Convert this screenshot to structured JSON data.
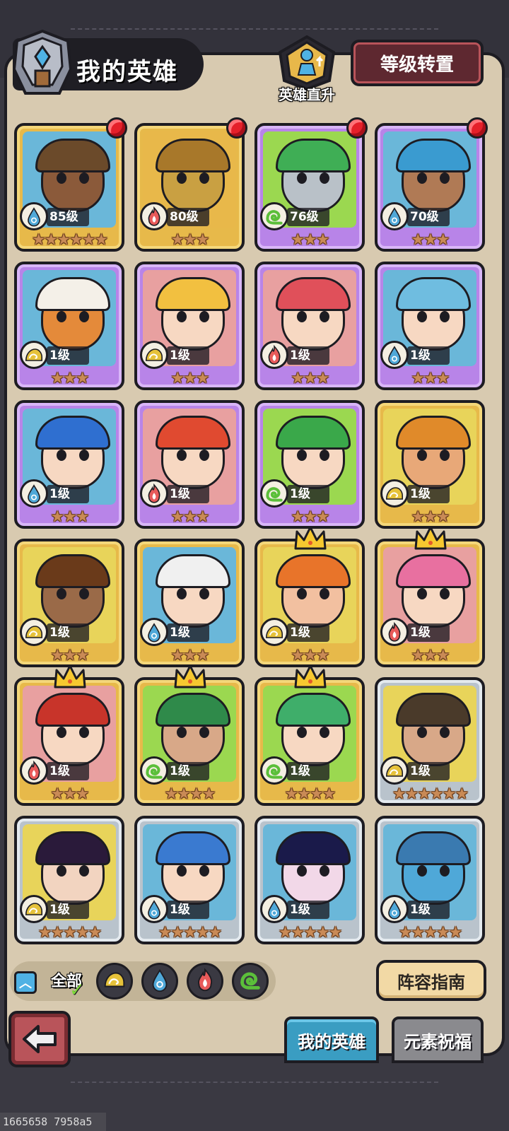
{
  "header": {
    "title": "我的英雄",
    "level_up_label": "英雄直升",
    "transfer_button": "等级转置"
  },
  "colors": {
    "panel": "#d8cab0",
    "rarity_gold": "#e7b94a",
    "rarity_purple": "#b884e8",
    "rarity_silver": "#b9c3cc",
    "element_water": "#4fa8d8",
    "element_fire": "#e85a5a",
    "element_wind": "#5bbf3a",
    "element_earth": "#e6c23a"
  },
  "heroes": [
    {
      "level": "85级",
      "stars": "★★★★★★",
      "element": "water",
      "rarity": "gold",
      "reddot": true,
      "crown": false,
      "bg": "#6ab7d9",
      "skin": "#8b5a3a",
      "hair": "#6b4a2a"
    },
    {
      "level": "80级",
      "stars": "★★★",
      "element": "fire",
      "rarity": "gold",
      "reddot": true,
      "crown": false,
      "bg": "#e8b84a",
      "skin": "#c9a042",
      "hair": "#a8782a"
    },
    {
      "level": "76级",
      "stars": "★★★",
      "element": "wind",
      "rarity": "purple",
      "reddot": true,
      "crown": false,
      "bg": "#9bd850",
      "skin": "#b9c1c8",
      "hair": "#3fae55"
    },
    {
      "level": "70级",
      "stars": "★★★",
      "element": "water",
      "rarity": "purple",
      "reddot": true,
      "crown": false,
      "bg": "#6ab7d9",
      "skin": "#b07a55",
      "hair": "#3a9bd0"
    },
    {
      "level": "1级",
      "stars": "★★★",
      "element": "earth",
      "rarity": "purple",
      "reddot": false,
      "crown": false,
      "bg": "#6ab7d9",
      "skin": "#e48a3a",
      "hair": "#f4f0e8"
    },
    {
      "level": "1级",
      "stars": "★★★",
      "element": "earth",
      "rarity": "purple",
      "reddot": false,
      "crown": false,
      "bg": "#e8a0a0",
      "skin": "#f7d8c2",
      "hair": "#f2c040"
    },
    {
      "level": "1级",
      "stars": "★★★",
      "element": "fire",
      "rarity": "purple",
      "reddot": false,
      "crown": false,
      "bg": "#e8a0a0",
      "skin": "#f7d8c2",
      "hair": "#e0505a"
    },
    {
      "level": "1级",
      "stars": "★★★",
      "element": "water",
      "rarity": "purple",
      "reddot": false,
      "crown": false,
      "bg": "#6ab7d9",
      "skin": "#f7d8c2",
      "hair": "#6fbde0"
    },
    {
      "level": "1级",
      "stars": "★★★",
      "element": "water",
      "rarity": "purple",
      "reddot": false,
      "crown": false,
      "bg": "#6ab7d9",
      "skin": "#f7d8c2",
      "hair": "#2f6fd0"
    },
    {
      "level": "1级",
      "stars": "★★★",
      "element": "fire",
      "rarity": "purple",
      "reddot": false,
      "crown": false,
      "bg": "#e8a0a0",
      "skin": "#f7d8c2",
      "hair": "#e04a30"
    },
    {
      "level": "1级",
      "stars": "★★★",
      "element": "wind",
      "rarity": "purple",
      "reddot": false,
      "crown": false,
      "bg": "#9bd850",
      "skin": "#f7d8c2",
      "hair": "#3aa84a"
    },
    {
      "level": "1级",
      "stars": "★★★",
      "element": "earth",
      "rarity": "gold",
      "reddot": false,
      "crown": false,
      "bg": "#e8d45a",
      "skin": "#e8a878",
      "hair": "#e08a2a"
    },
    {
      "level": "1级",
      "stars": "★★★",
      "element": "earth",
      "rarity": "gold",
      "reddot": false,
      "crown": false,
      "bg": "#e8d45a",
      "skin": "#9a6a48",
      "hair": "#6a3a1a"
    },
    {
      "level": "1级",
      "stars": "★★★",
      "element": "water",
      "rarity": "gold",
      "reddot": false,
      "crown": false,
      "bg": "#6ab7d9",
      "skin": "#f7d8c2",
      "hair": "#f0f0f0"
    },
    {
      "level": "1级",
      "stars": "★★★",
      "element": "earth",
      "rarity": "gold",
      "reddot": false,
      "crown": true,
      "bg": "#e8d45a",
      "skin": "#f2c0a0",
      "hair": "#e8742a"
    },
    {
      "level": "1级",
      "stars": "★★★",
      "element": "fire",
      "rarity": "gold",
      "reddot": false,
      "crown": true,
      "bg": "#e8a0a0",
      "skin": "#f7d8c2",
      "hair": "#e870a0"
    },
    {
      "level": "1级",
      "stars": "★★★",
      "element": "fire",
      "rarity": "gold",
      "reddot": false,
      "crown": true,
      "bg": "#e8a0a0",
      "skin": "#f7d8c2",
      "hair": "#c8342a"
    },
    {
      "level": "1级",
      "stars": "★★★★",
      "element": "wind",
      "rarity": "gold",
      "reddot": false,
      "crown": true,
      "bg": "#9bd850",
      "skin": "#d8a888",
      "hair": "#2f8a4a"
    },
    {
      "level": "1级",
      "stars": "★★★★",
      "element": "wind",
      "rarity": "gold",
      "reddot": false,
      "crown": true,
      "bg": "#9bd850",
      "skin": "#f7d8c2",
      "hair": "#3fae6a"
    },
    {
      "level": "1级",
      "stars": "★★★★★★",
      "element": "earth",
      "rarity": "silver",
      "reddot": false,
      "crown": false,
      "bg": "#e8d45a",
      "skin": "#d8a888",
      "hair": "#4a3a2a"
    },
    {
      "level": "1级",
      "stars": "★★★★★",
      "element": "earth",
      "rarity": "silver",
      "reddot": false,
      "crown": false,
      "bg": "#e8d45a",
      "skin": "#f2d4c0",
      "hair": "#2a1a3a"
    },
    {
      "level": "1级",
      "stars": "★★★★★",
      "element": "water",
      "rarity": "silver",
      "reddot": false,
      "crown": false,
      "bg": "#6ab7d9",
      "skin": "#f7d8c2",
      "hair": "#3a7ad0"
    },
    {
      "level": "1级",
      "stars": "★★★★★",
      "element": "water",
      "rarity": "silver",
      "reddot": false,
      "crown": false,
      "bg": "#6ab7d9",
      "skin": "#f2d8e8",
      "hair": "#1a1a4a"
    },
    {
      "level": "1级",
      "stars": "★★★★★",
      "element": "water",
      "rarity": "silver",
      "reddot": false,
      "crown": false,
      "bg": "#6ab7d9",
      "skin": "#4fa8d8",
      "hair": "#3a7ab0"
    }
  ],
  "filters": {
    "all_label": "全部",
    "elements": [
      "earth",
      "water",
      "fire",
      "wind"
    ]
  },
  "guide_button": "阵容指南",
  "tabs": {
    "my_heroes": "我的英雄",
    "element_blessing": "元素祝福"
  },
  "footer_id": "1665658 7958a5"
}
